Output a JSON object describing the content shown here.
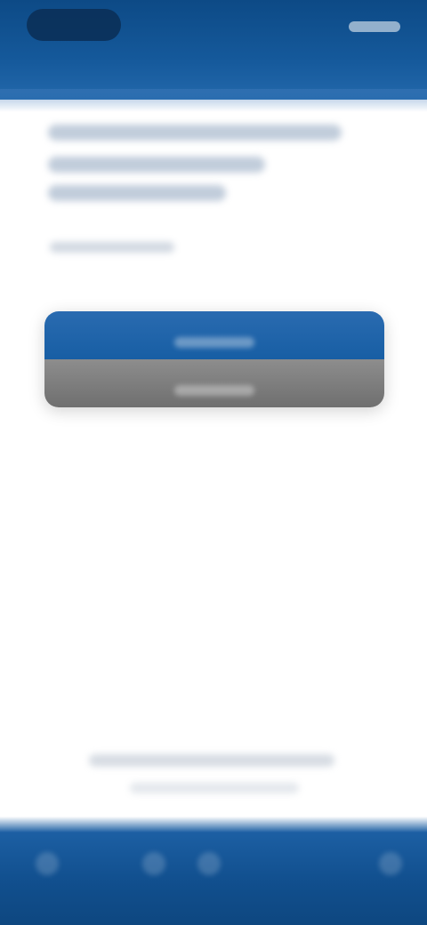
{
  "header": {
    "logo_text": "",
    "status_text": ""
  },
  "main": {
    "heading_lines": [
      "",
      "",
      ""
    ],
    "subtext": ""
  },
  "actions": {
    "primary_label": "",
    "secondary_label": ""
  },
  "footer": {
    "line1": "",
    "line2": ""
  },
  "bottom_nav": {
    "items": [
      {
        "icon": "home-icon",
        "label": ""
      },
      {
        "icon": "search-icon",
        "label": ""
      },
      {
        "icon": "bookmark-icon",
        "label": ""
      },
      {
        "icon": "menu-icon",
        "label": ""
      }
    ]
  },
  "colors": {
    "header_bg": "#15599b",
    "primary_button": "#1f65aa",
    "secondary_button": "#7a7a7a",
    "background": "#ffffff"
  }
}
